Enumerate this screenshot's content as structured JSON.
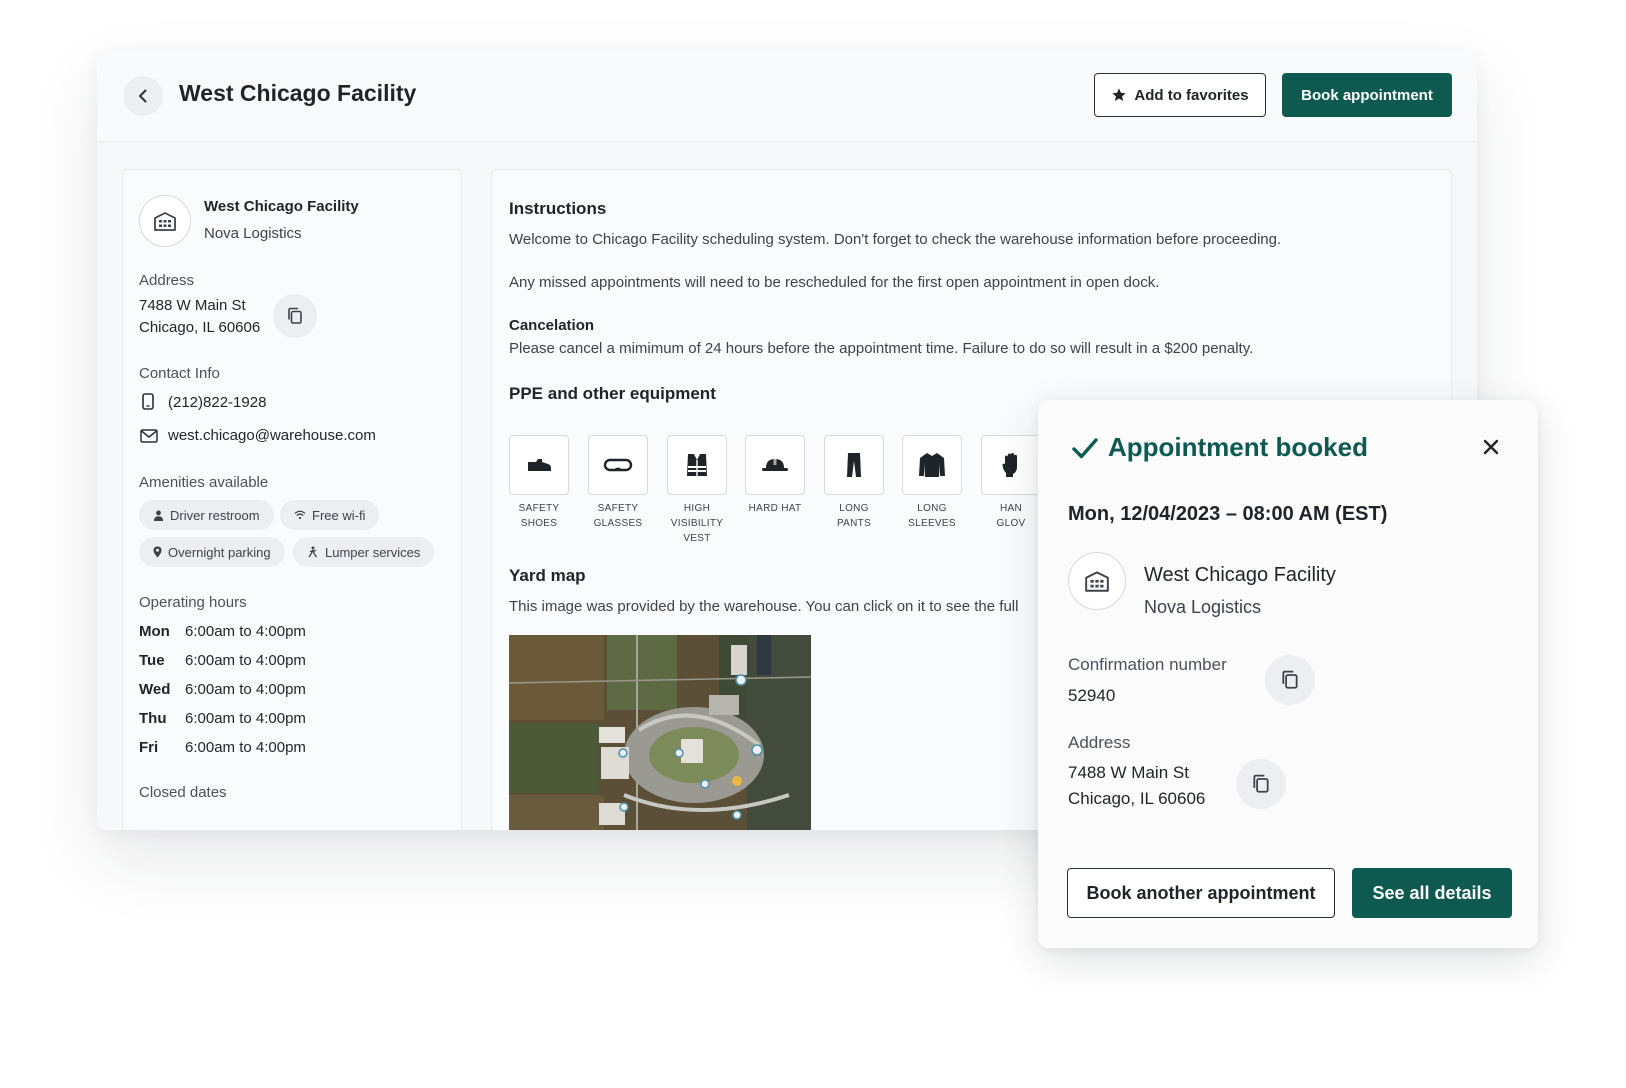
{
  "header": {
    "title": "West Chicago Facility",
    "favorites_label": "Add to favorites",
    "book_label": "Book appointment"
  },
  "facility": {
    "name": "West Chicago Facility",
    "org": "Nova Logistics",
    "address_label": "Address",
    "address_line1": "7488 W Main St",
    "address_line2": "Chicago, IL 60606",
    "contact_label": "Contact Info",
    "phone": "(212)822-1928",
    "email": "west.chicago@warehouse.com",
    "amenities_label": "Amenities available",
    "amenities": [
      "Driver restroom",
      "Free wi-fi",
      "Overnight parking",
      "Lumper services"
    ],
    "hours_label": "Operating hours",
    "hours": [
      {
        "day": "Mon",
        "time": "6:00am to 4:00pm"
      },
      {
        "day": "Tue",
        "time": "6:00am to 4:00pm"
      },
      {
        "day": "Wed",
        "time": "6:00am to 4:00pm"
      },
      {
        "day": "Thu",
        "time": "6:00am to 4:00pm"
      },
      {
        "day": "Fri",
        "time": "6:00am to 4:00pm"
      }
    ],
    "closed_label": "Closed dates"
  },
  "main": {
    "instructions_title": "Instructions",
    "instructions_p1": "Welcome to Chicago Facility scheduling system. Don't forget to check the warehouse information before proceeding.",
    "instructions_p2": "Any missed appointments will need to be rescheduled for the first open appointment in open dock.",
    "cancel_title": "Cancelation",
    "cancel_text": "Please cancel a mimimum of 24 hours before the appointment time. Failure to do so will result in a $200 penalty.",
    "ppe_title": "PPE and other equipment",
    "ppe": [
      {
        "line1": "SAFETY",
        "line2": "SHOES",
        "line3": ""
      },
      {
        "line1": "SAFETY",
        "line2": "GLASSES",
        "line3": ""
      },
      {
        "line1": "HIGH",
        "line2": "VISIBILITY",
        "line3": "VEST"
      },
      {
        "line1": "HARD HAT",
        "line2": "",
        "line3": ""
      },
      {
        "line1": "LONG",
        "line2": "PANTS",
        "line3": ""
      },
      {
        "line1": "LONG",
        "line2": "SLEEVES",
        "line3": ""
      },
      {
        "line1": "HAN",
        "line2": "GLOV",
        "line3": ""
      }
    ],
    "yard_title": "Yard map",
    "yard_text": "This image was provided by the warehouse. You can click on it to see the full"
  },
  "modal": {
    "title": "Appointment booked",
    "datetime": "Mon, 12/04/2023 – 08:00 AM (EST)",
    "facility_name": "West Chicago Facility",
    "facility_org": "Nova Logistics",
    "confirmation_label": "Confirmation number",
    "confirmation_value": "52940",
    "address_label": "Address",
    "address_line1": "7488 W Main St",
    "address_line2": "Chicago, IL 60606",
    "btn_another": "Book another appointment",
    "btn_details": "See all details"
  },
  "colors": {
    "brand": "#0e5a51",
    "panel": "#fafbfc",
    "chip": "#eceef1"
  }
}
